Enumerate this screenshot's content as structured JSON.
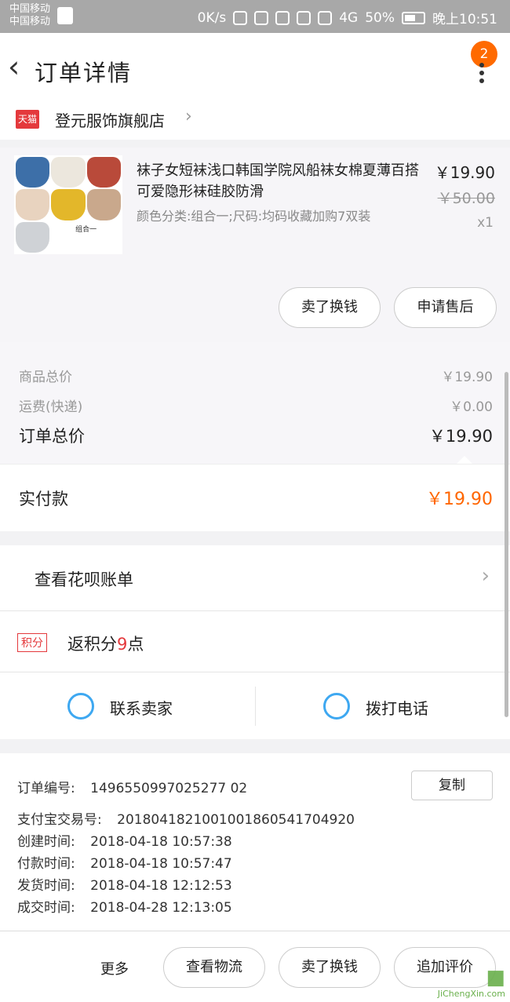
{
  "status": {
    "carrier1": "中国移动",
    "carrier2": "中国移动",
    "speed": "0K/s",
    "net": "4G",
    "battery": "50%",
    "time": "晚上10:51"
  },
  "header": {
    "title": "订单详情",
    "badge": "2"
  },
  "store": {
    "tag": "天猫",
    "name": "登元服饰旗舰店"
  },
  "product": {
    "thumb_label": "组合一",
    "title": "袜子女短袜浅口韩国学院风船袜女棉夏薄百搭可爱隐形袜硅胶防滑",
    "spec": "颜色分类:组合一;尺码:均码收藏加购7双装",
    "price": "￥19.90",
    "original_price": "￥50.00",
    "quantity": "x1",
    "btn_sell": "卖了换钱",
    "btn_aftersale": "申请售后",
    "colors": [
      "#3d6fa8",
      "#ece7dd",
      "#b94a3a",
      "#e8d3bf",
      "#e3b72a",
      "#c9a88c",
      "#cfd2d6"
    ]
  },
  "summary": {
    "goods_label": "商品总价",
    "goods_value": "￥19.90",
    "shipping_label": "运费(快递)",
    "shipping_value": "￥0.00",
    "total_label": "订单总价",
    "total_value": "￥19.90",
    "paid_label": "实付款",
    "paid_value": "￥19.90"
  },
  "huabei": {
    "label": "查看花呗账单"
  },
  "points": {
    "tag": "积分",
    "prefix": "返积分",
    "count": "9",
    "suffix": "点"
  },
  "contact": {
    "seller": "联系卖家",
    "call": "拨打电话"
  },
  "order": {
    "no_label": "订单编号:",
    "no_value": "1496550997025277 02",
    "copy": "复制",
    "alipay_label": "支付宝交易号:",
    "alipay_value": "2018041821001001860541704920",
    "created_label": "创建时间:",
    "created_value": "2018-04-18 10:57:38",
    "paid_label": "付款时间:",
    "paid_value": "2018-04-18 10:57:47",
    "shipped_label": "发货时间:",
    "shipped_value": "2018-04-18 12:12:53",
    "closed_label": "成交时间:",
    "closed_value": "2018-04-28 12:13:05"
  },
  "bottom": {
    "more": "更多",
    "logistics": "查看物流",
    "sell": "卖了换钱",
    "review": "追加评价"
  },
  "watermark": {
    "text": "JiChengXin.com"
  }
}
